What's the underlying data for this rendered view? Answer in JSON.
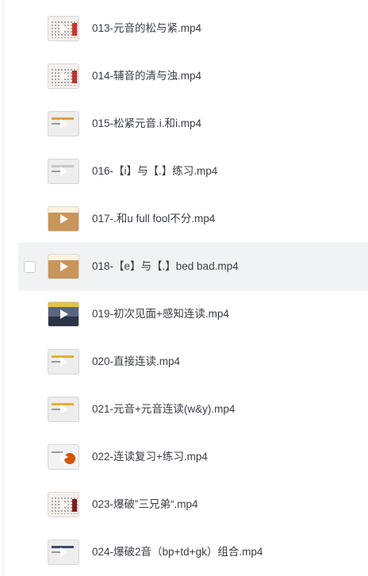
{
  "files": [
    {
      "name": "013-元音的松与紧.mp4",
      "thumb_style": "dots",
      "accent": "#c0392b"
    },
    {
      "name": "014-辅音的清与浊.mp4",
      "thumb_style": "dots",
      "accent": "#b03a2e"
    },
    {
      "name": "015-松紧元音.i.和i.mp4",
      "thumb_style": "light",
      "accent": "#d9a441"
    },
    {
      "name": "016-【i】与【.】练习.mp4",
      "thumb_style": "light",
      "accent": "#c9c9c9"
    },
    {
      "name": "017-.和u full fool不分.mp4",
      "thumb_style": "tan",
      "accent": "#c8955a"
    },
    {
      "name": "018-【e】与【.】bed bad.mp4",
      "thumb_style": "tan",
      "accent": "#c8955a"
    },
    {
      "name": "019-初次见面+感知连读.mp4",
      "thumb_style": "city",
      "accent": "#3b4a6b"
    },
    {
      "name": "020-直接连读.mp4",
      "thumb_style": "light",
      "accent": "#e0b030"
    },
    {
      "name": "021-元音+元音连读(w&y).mp4",
      "thumb_style": "light",
      "accent": "#e0b030"
    },
    {
      "name": "022-连读复习+练习.mp4",
      "thumb_style": "food",
      "accent": "#d35400"
    },
    {
      "name": "023-爆破”三兄弟“.mp4",
      "thumb_style": "dots",
      "accent": "#7a1f1f"
    },
    {
      "name": "024-爆破2音（bp+td+gk）组合.mp4",
      "thumb_style": "light",
      "accent": "#3b4a6b"
    }
  ],
  "highlighted_index": 5
}
